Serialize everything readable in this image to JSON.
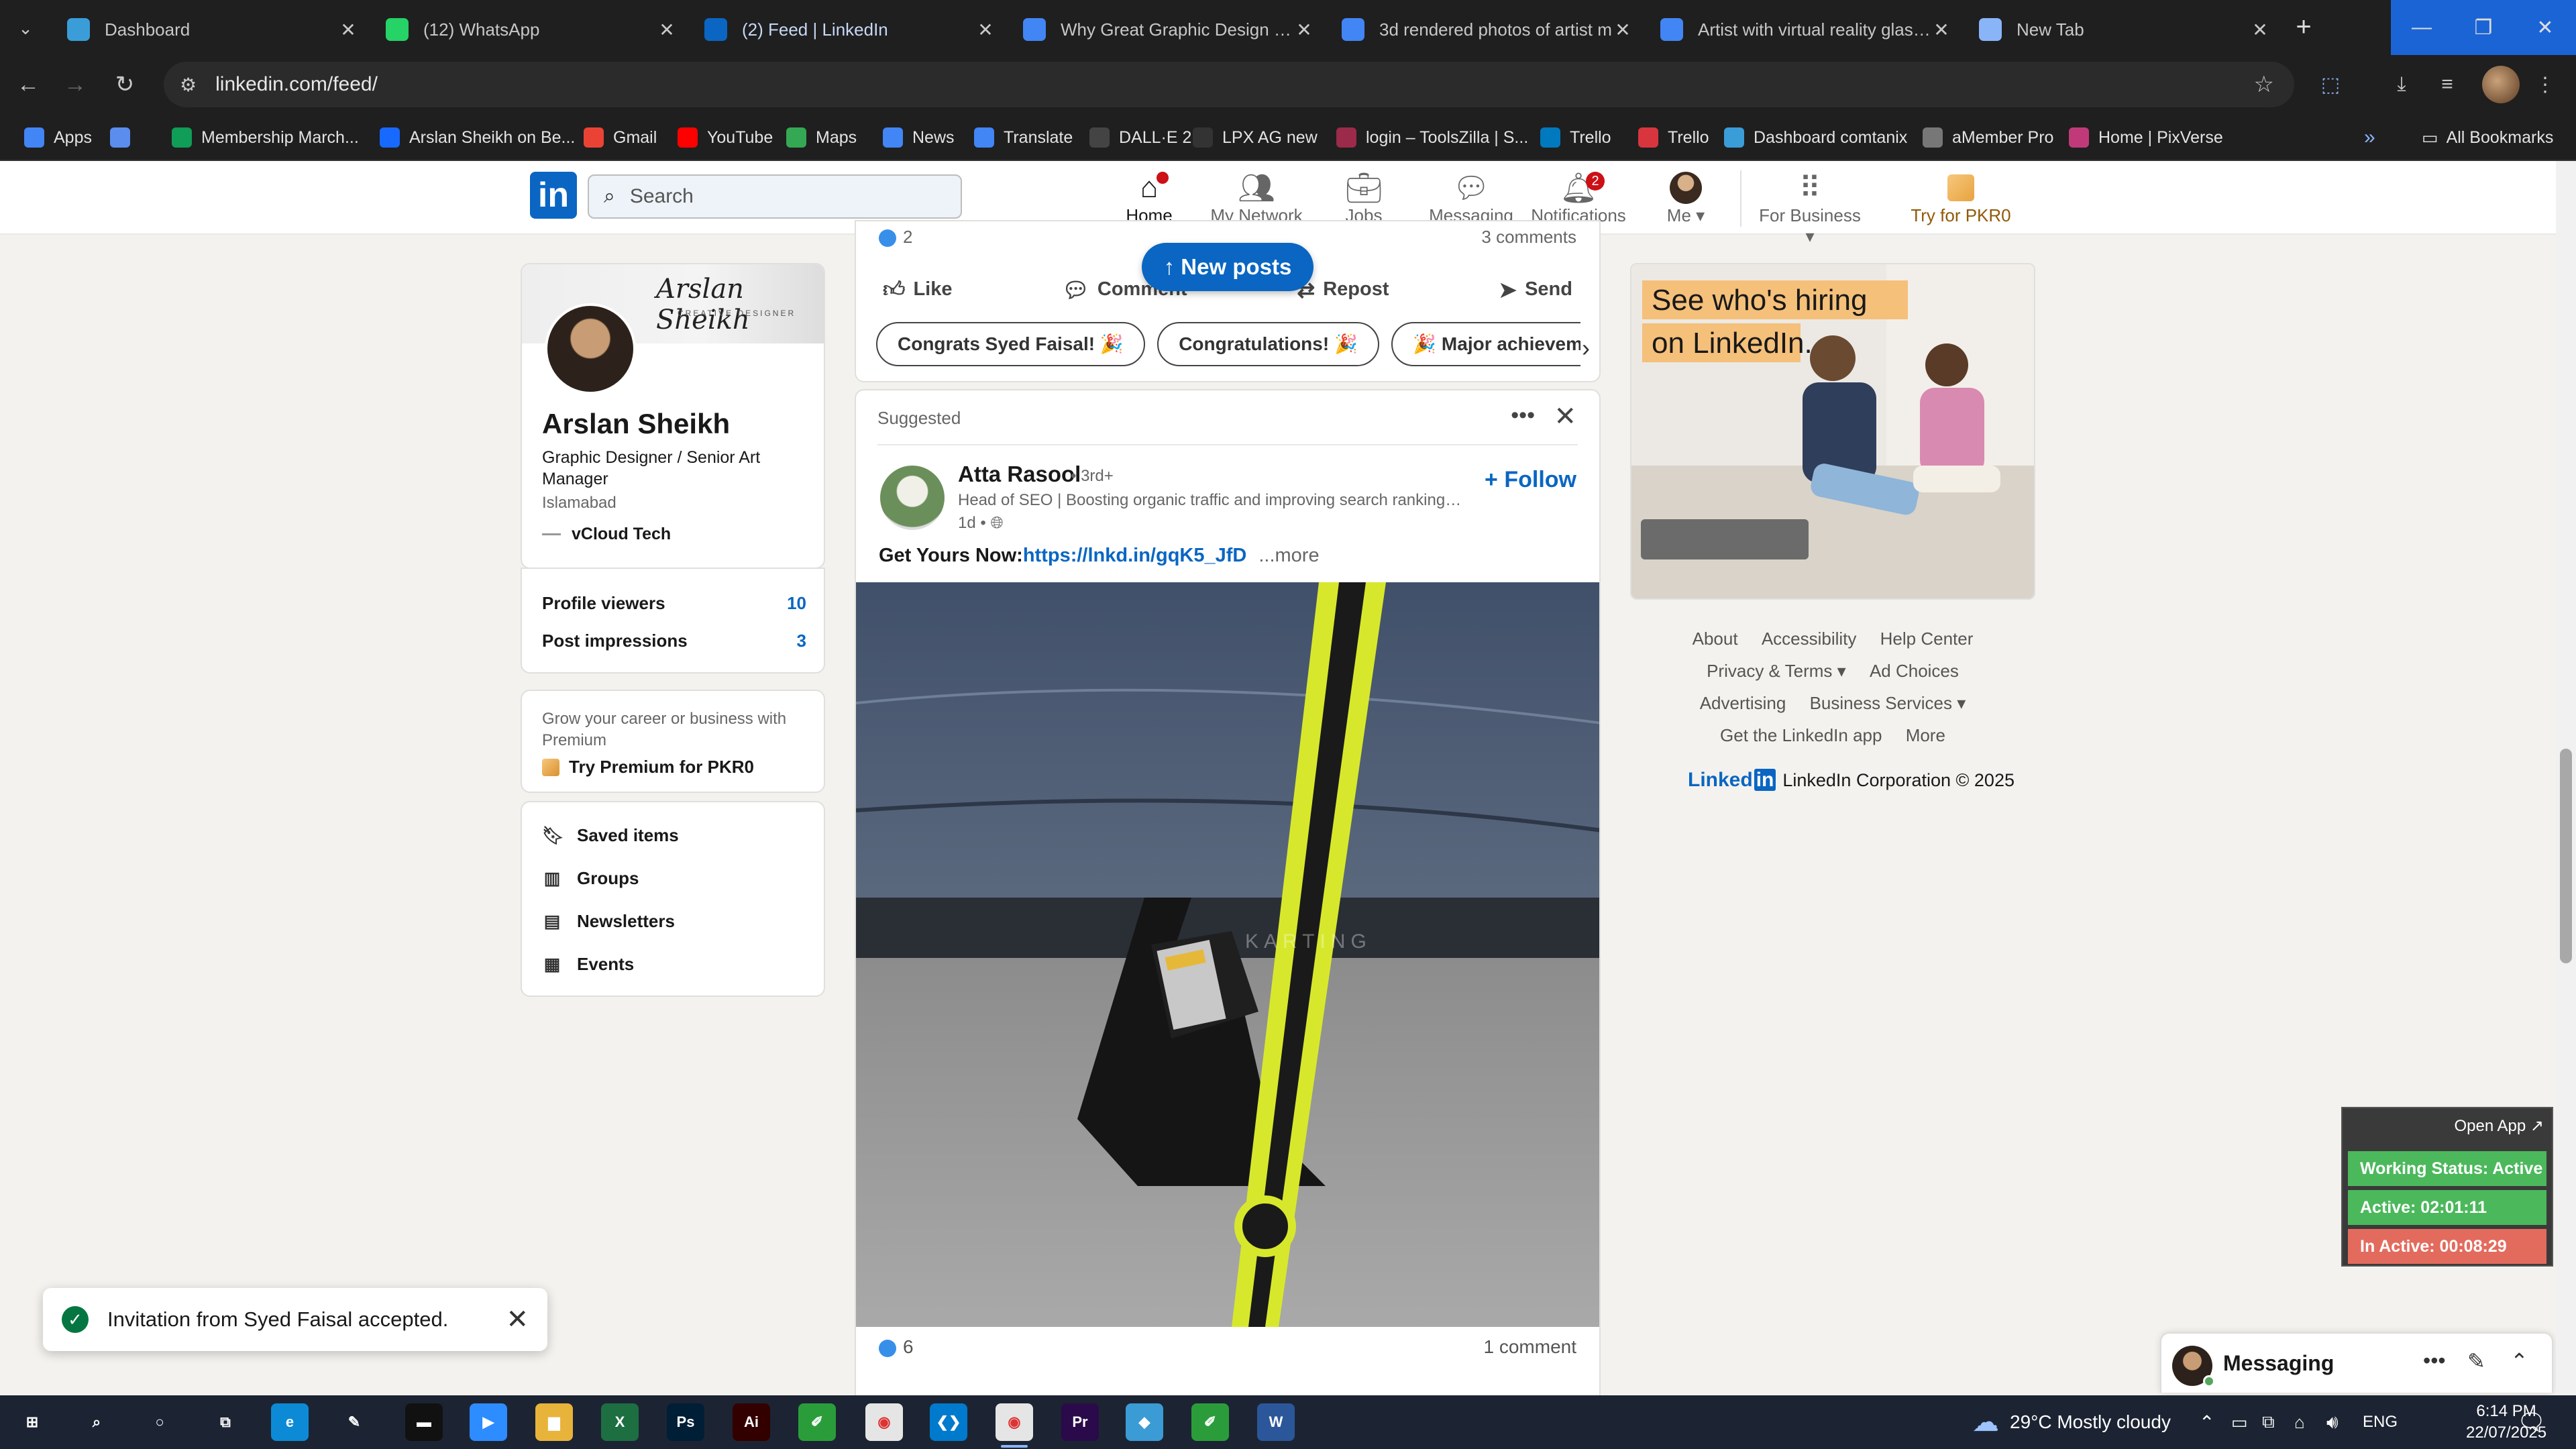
{
  "browser": {
    "tabs": [
      {
        "title": "Dashboard",
        "icon": "dashboard-favicon",
        "color": "#3a9dd8",
        "active": false
      },
      {
        "title": "(12) WhatsApp",
        "icon": "whatsapp-favicon",
        "color": "#25d366",
        "active": false
      },
      {
        "title": "(2) Feed | LinkedIn",
        "icon": "linkedin-favicon",
        "color": "#0a66c2",
        "active": true
      },
      {
        "title": "Why Great Graphic Design Is M",
        "icon": "docs-favicon",
        "color": "#4285f4",
        "active": false
      },
      {
        "title": "3d rendered photos of artist m",
        "icon": "docs-favicon",
        "color": "#4285f4",
        "active": false
      },
      {
        "title": "Artist with virtual reality glasse",
        "icon": "docs-favicon",
        "color": "#4285f4",
        "active": false
      },
      {
        "title": "New Tab",
        "icon": "chrome-favicon",
        "color": "#8ab4f8",
        "active": false
      }
    ],
    "url": "linkedin.com/feed/",
    "bookmarks": [
      {
        "label": "Apps",
        "icon": "apps-grid-icon",
        "color": "#4285f4"
      },
      {
        "label": "",
        "icon": "grid-icon",
        "color": "#5b8def"
      },
      {
        "label": "Membership March...",
        "icon": "sheets-icon",
        "color": "#0f9d58"
      },
      {
        "label": "Arslan Sheikh on Be...",
        "icon": "behance-icon",
        "color": "#1769ff"
      },
      {
        "label": "Gmail",
        "icon": "gmail-icon",
        "color": "#ea4335"
      },
      {
        "label": "YouTube",
        "icon": "youtube-icon",
        "color": "#ff0000"
      },
      {
        "label": "Maps",
        "icon": "maps-icon",
        "color": "#34a853"
      },
      {
        "label": "News",
        "icon": "news-icon",
        "color": "#4285f4"
      },
      {
        "label": "Translate",
        "icon": "translate-icon",
        "color": "#4285f4"
      },
      {
        "label": "DALL·E 2",
        "icon": "dalle-icon",
        "color": "#444444"
      },
      {
        "label": "LPX AG new",
        "icon": "lpx-icon",
        "color": "#333333"
      },
      {
        "label": "login – ToolsZilla | S...",
        "icon": "toolszilla-icon",
        "color": "#9c2a4a"
      },
      {
        "label": "Trello",
        "icon": "trello-icon",
        "color": "#0079bf"
      },
      {
        "label": "Trello",
        "icon": "trello-icon",
        "color": "#d9353f"
      },
      {
        "label": "Dashboard comtanix",
        "icon": "comtanix-icon",
        "color": "#3a9dd8"
      },
      {
        "label": "aMember Pro",
        "icon": "amember-icon",
        "color": "#777777"
      },
      {
        "label": "Home | PixVerse",
        "icon": "pixverse-icon",
        "color": "#c03a7a"
      }
    ],
    "all_bookmarks": "All Bookmarks"
  },
  "linkedin": {
    "search_placeholder": "Search",
    "nav": [
      {
        "label": "Home",
        "icon": "home-icon",
        "badge": "",
        "active": true
      },
      {
        "label": "My Network",
        "icon": "network-icon",
        "badge": "",
        "active": false
      },
      {
        "label": "Jobs",
        "icon": "briefcase-icon",
        "badge": "",
        "active": false
      },
      {
        "label": "Messaging",
        "icon": "messaging-icon",
        "badge": "",
        "active": false
      },
      {
        "label": "Notifications",
        "icon": "bell-icon",
        "badge": "2",
        "active": false
      },
      {
        "label": "Me ▾",
        "icon": "me-avatar",
        "badge": "",
        "active": false
      }
    ],
    "business": "For Business ▾",
    "premium_try": "Try for PKR0"
  },
  "profile": {
    "banner_signature": "Arslan Sheikh",
    "banner_sub": "CREATIVE DESIGNER",
    "name": "Arslan Sheikh",
    "title": "Graphic Designer / Senior Art Manager",
    "location": "Islamabad",
    "company": "vCloud Tech",
    "stats": [
      {
        "label": "Profile viewers",
        "value": "10"
      },
      {
        "label": "Post impressions",
        "value": "3"
      }
    ],
    "premium_text": "Grow your career or business with Premium",
    "premium_link": "Try Premium for PKR0",
    "links": [
      {
        "label": "Saved items",
        "icon": "bookmark-icon"
      },
      {
        "label": "Groups",
        "icon": "groups-icon"
      },
      {
        "label": "Newsletters",
        "icon": "newsletter-icon"
      },
      {
        "label": "Events",
        "icon": "calendar-icon"
      }
    ]
  },
  "feed": {
    "prev_post": {
      "reactions": "2",
      "comments": "3 comments",
      "actions": [
        "Like",
        "Comment",
        "Repost",
        "Send"
      ],
      "chips": [
        "Congrats Syed Faisal! 🎉",
        "Congratulations! 🎉",
        "🎉 Major achievement"
      ]
    },
    "new_posts": "↑ New posts",
    "post": {
      "label": "Suggested",
      "author": "Atta Rasool",
      "degree": "• 3rd+",
      "headline": "Head of SEO | Boosting organic traffic and improving search rankings f...",
      "time": "1d •",
      "follow": "+ Follow",
      "text_prefix": "Get Yours Now:",
      "text_link": "https://lnkd.in/gqK5_JfD",
      "text_more": "...more",
      "watermark": "KARTING",
      "reactions": "6",
      "comments": "1 comment"
    }
  },
  "right": {
    "ad_line1": "See who's hiring",
    "ad_line2": "on LinkedIn.",
    "footer_row1": [
      "About",
      "Accessibility",
      "Help Center"
    ],
    "footer_row2": [
      "Privacy & Terms ▾",
      "Ad Choices"
    ],
    "footer_row3": [
      "Advertising",
      "Business Services ▾"
    ],
    "footer_row4": [
      "Get the LinkedIn app",
      "More"
    ],
    "corp_logo": "Linked",
    "corp": "LinkedIn Corporation © 2025"
  },
  "work_status": {
    "open": "Open App ↗",
    "status": "Working Status: Active",
    "active": "Active: 02:01:11",
    "inactive": "In Active: 00:08:29"
  },
  "messaging": {
    "title": "Messaging"
  },
  "toast": {
    "text": "Invitation from Syed Faisal accepted."
  },
  "taskbar": {
    "apps": [
      {
        "icon": "windows-start-icon",
        "color": "#1c2433"
      },
      {
        "icon": "search-icon",
        "color": "#1c2433"
      },
      {
        "icon": "cortana-icon",
        "color": "#1c2433"
      },
      {
        "icon": "task-view-icon",
        "color": "#1c2433"
      },
      {
        "icon": "edge-icon",
        "color": "#0c8ad6"
      },
      {
        "icon": "pen-icon",
        "color": "#1c2433"
      },
      {
        "icon": "terminal-icon",
        "color": "#111111"
      },
      {
        "icon": "zoom-icon",
        "color": "#2d8cff"
      },
      {
        "icon": "folder-icon",
        "color": "#e8b33a"
      },
      {
        "icon": "excel-icon",
        "color": "#1d6f42"
      },
      {
        "icon": "photoshop-icon",
        "color": "#001e36"
      },
      {
        "icon": "illustrator-icon",
        "color": "#330000"
      },
      {
        "icon": "corel-icon",
        "color": "#2a9d3a"
      },
      {
        "icon": "chrome-icon",
        "color": "#e5e5e5"
      },
      {
        "icon": "vscode-icon",
        "color": "#007acc"
      },
      {
        "icon": "chrome-profile-icon",
        "color": "#e5e5e5"
      },
      {
        "icon": "premiere-icon",
        "color": "#2a0a4a"
      },
      {
        "icon": "app-icon",
        "color": "#3b9bd4"
      },
      {
        "icon": "corel-icon",
        "color": "#2a9d3a"
      },
      {
        "icon": "word-icon",
        "color": "#2b579a"
      }
    ],
    "weather": "29°C  Mostly cloudy",
    "lang": "ENG",
    "time": "6:14 PM",
    "date": "22/07/2025",
    "notif_count": "1"
  }
}
